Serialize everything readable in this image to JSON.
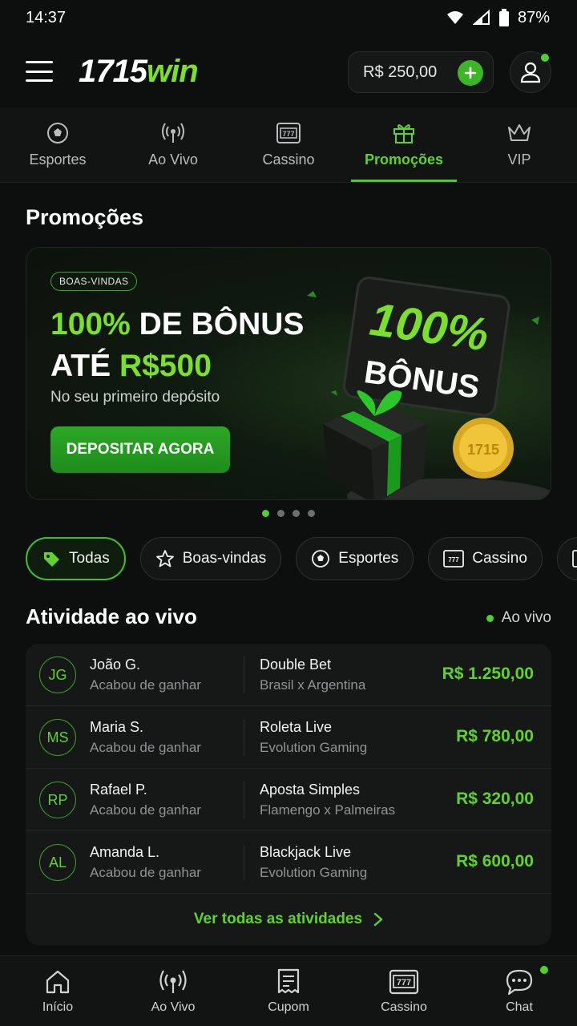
{
  "status": {
    "time": "14:37",
    "battery": "87%"
  },
  "header": {
    "logo_num": "1715",
    "logo_win": "win",
    "balance": "R$ 250,00"
  },
  "topnav": [
    {
      "label": "Esportes",
      "icon": "soccer-ball-icon",
      "active": false
    },
    {
      "label": "Ao Vivo",
      "icon": "broadcast-icon",
      "active": false
    },
    {
      "label": "Cassino",
      "icon": "slot-machine-icon",
      "active": false
    },
    {
      "label": "Promoções",
      "icon": "gift-icon",
      "active": true
    },
    {
      "label": "VIP",
      "icon": "crown-icon",
      "active": false
    }
  ],
  "page_title": "Promoções",
  "banner": {
    "badge": "BOAS-VINDAS",
    "line1_green": "100%",
    "line1_white": " DE BÔNUS",
    "line2_white": "ATÉ ",
    "line2_green": "R$500",
    "subtitle": "No seu primeiro depósito",
    "cta": "DEPOSITAR AGORA",
    "art_percent": "100%",
    "art_word": "BÔNUS",
    "coin_text": "1715",
    "slide_count": 4,
    "slide_active": 1
  },
  "chips": [
    {
      "label": "Todas",
      "icon": "tag-icon",
      "active": true
    },
    {
      "label": "Boas-vindas",
      "icon": "star-icon",
      "active": false
    },
    {
      "label": "Esportes",
      "icon": "soccer-ball-icon",
      "active": false
    },
    {
      "label": "Cassino",
      "icon": "slot-machine-icon",
      "active": false
    }
  ],
  "activity": {
    "title": "Atividade ao vivo",
    "live_label": "Ao vivo",
    "rows": [
      {
        "initials": "JG",
        "name": "João G.",
        "action": "Acabou de ganhar",
        "game": "Double Bet",
        "detail": "Brasil x Argentina",
        "amount": "R$ 1.250,00"
      },
      {
        "initials": "MS",
        "name": "Maria S.",
        "action": "Acabou de ganhar",
        "game": "Roleta Live",
        "detail": "Evolution Gaming",
        "amount": "R$ 780,00"
      },
      {
        "initials": "RP",
        "name": "Rafael P.",
        "action": "Acabou de ganhar",
        "game": "Aposta Simples",
        "detail": "Flamengo x Palmeiras",
        "amount": "R$ 320,00"
      },
      {
        "initials": "AL",
        "name": "Amanda L.",
        "action": "Acabou de ganhar",
        "game": "Blackjack Live",
        "detail": "Evolution Gaming",
        "amount": "R$ 600,00"
      }
    ],
    "see_all": "Ver todas as atividades"
  },
  "bottomnav": [
    {
      "label": "Início",
      "icon": "home-icon"
    },
    {
      "label": "Ao Vivo",
      "icon": "broadcast-icon"
    },
    {
      "label": "Cupom",
      "icon": "ticket-icon"
    },
    {
      "label": "Cassino",
      "icon": "slot-machine-icon"
    },
    {
      "label": "Chat",
      "icon": "chat-icon",
      "badge": true
    }
  ],
  "colors": {
    "accent": "#5fd32a",
    "background": "#0d0f0f",
    "card": "#161818"
  }
}
